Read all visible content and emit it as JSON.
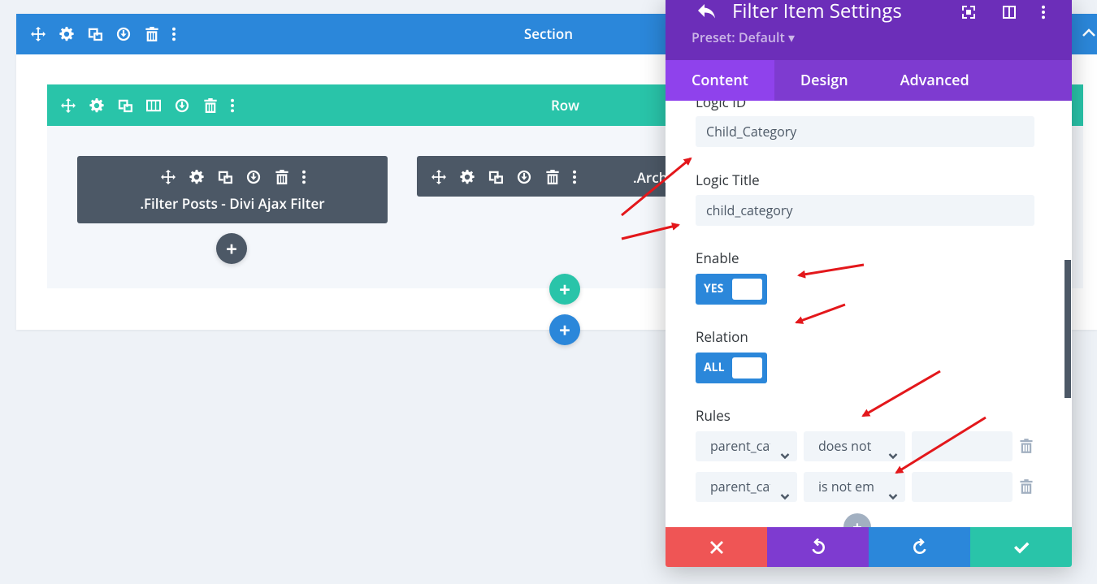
{
  "section": {
    "title": "Section"
  },
  "row": {
    "title": "Row"
  },
  "modules": [
    {
      "title": ".Filter Posts - Divi Ajax Filter"
    },
    {
      "title": ".Arch"
    }
  ],
  "modal": {
    "title": "Filter Item Settings",
    "preset": "Preset: Default ▾",
    "tabs": [
      "Content",
      "Design",
      "Advanced"
    ],
    "fields": {
      "logic_id_label": "Logic ID",
      "logic_id_value": "Child_Category",
      "logic_title_label": "Logic Title",
      "logic_title_value": "child_category",
      "enable_label": "Enable",
      "enable_value": "YES",
      "relation_label": "Relation",
      "relation_value": "ALL",
      "rules_label": "Rules"
    },
    "rules": [
      {
        "field": "parent_category",
        "operator": "does not",
        "value": ""
      },
      {
        "field": "parent_category",
        "operator": "is not em",
        "value": ""
      }
    ]
  },
  "colors": {
    "section": "#2b87da",
    "row": "#29c4a9",
    "module": "#4c5866",
    "modal_header": "#6c2eb9",
    "tabs": "#7e3bd0",
    "cancel": "#ef5555",
    "undo": "#7e3bd0",
    "redo": "#2b87da",
    "save": "#29c4a9",
    "annotation": "#e3171b"
  },
  "icons": [
    "move-icon",
    "gear-icon",
    "duplicate-icon",
    "power-icon",
    "trash-icon",
    "dots-icon",
    "columns-icon",
    "plus-icon",
    "back-icon",
    "fullscreen-icon",
    "split-icon",
    "chevron-down-icon",
    "close-icon",
    "undo-icon",
    "redo-icon",
    "check-icon"
  ]
}
